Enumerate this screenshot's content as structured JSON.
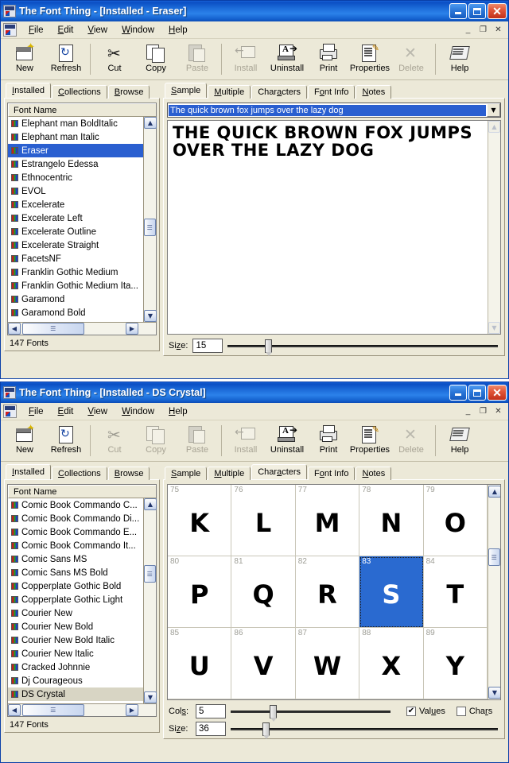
{
  "windows": [
    {
      "title": "The Font Thing - [Installed - Eraser]",
      "titlebar_buttons": {
        "minimize": "minimize-icon",
        "maximize": "maximize-icon",
        "close": "close-icon"
      },
      "mdi_buttons": {
        "minimize": "_",
        "restore": "❐",
        "close": "✕"
      },
      "menu": [
        {
          "pre": "",
          "acc": "F",
          "post": "ile"
        },
        {
          "pre": "",
          "acc": "E",
          "post": "dit"
        },
        {
          "pre": "",
          "acc": "V",
          "post": "iew"
        },
        {
          "pre": "",
          "acc": "W",
          "post": "indow"
        },
        {
          "pre": "",
          "acc": "H",
          "post": "elp"
        }
      ],
      "toolbar": [
        {
          "label": "New",
          "icon": "new-document-icon",
          "disabled": false
        },
        {
          "label": "Refresh",
          "icon": "refresh-icon",
          "disabled": false
        },
        {
          "sep": true
        },
        {
          "label": "Cut",
          "icon": "scissors-icon",
          "disabled": false
        },
        {
          "label": "Copy",
          "icon": "copy-icon",
          "disabled": false
        },
        {
          "label": "Paste",
          "icon": "paste-icon",
          "disabled": true
        },
        {
          "sep": true
        },
        {
          "label": "Install",
          "icon": "install-icon",
          "disabled": true
        },
        {
          "label": "Uninstall",
          "icon": "uninstall-icon",
          "disabled": false
        },
        {
          "label": "Print",
          "icon": "printer-icon",
          "disabled": false
        },
        {
          "label": "Properties",
          "icon": "properties-icon",
          "disabled": false
        },
        {
          "label": "Delete",
          "icon": "delete-x-icon",
          "disabled": true
        },
        {
          "sep": true
        },
        {
          "label": "Help",
          "icon": "help-book-icon",
          "disabled": false
        }
      ],
      "left_tabs": [
        {
          "acc": "I",
          "post": "nstalled",
          "active": true
        },
        {
          "acc": "C",
          "post": "ollections",
          "active": false
        },
        {
          "acc": "B",
          "post": "rowse",
          "active": false
        }
      ],
      "list_header": "Font Name",
      "fonts": [
        {
          "name": "Elephant man BoldItalic",
          "state": ""
        },
        {
          "name": "Elephant man Italic",
          "state": ""
        },
        {
          "name": "Eraser",
          "state": "sel-active"
        },
        {
          "name": "Estrangelo Edessa",
          "state": ""
        },
        {
          "name": "Ethnocentric",
          "state": ""
        },
        {
          "name": "EVOL",
          "state": ""
        },
        {
          "name": "Excelerate",
          "state": ""
        },
        {
          "name": "Excelerate Left",
          "state": ""
        },
        {
          "name": "Excelerate Outline",
          "state": ""
        },
        {
          "name": "Excelerate Straight",
          "state": ""
        },
        {
          "name": "FacetsNF",
          "state": ""
        },
        {
          "name": "Franklin Gothic Medium",
          "state": ""
        },
        {
          "name": "Franklin Gothic Medium Ita...",
          "state": ""
        },
        {
          "name": "Garamond",
          "state": ""
        },
        {
          "name": "Garamond Bold",
          "state": ""
        }
      ],
      "status": "147 Fonts",
      "right_tabs": [
        {
          "acc": "S",
          "post": "ample",
          "pre": "",
          "active": true
        },
        {
          "acc": "M",
          "post": "ultiple",
          "pre": "",
          "active": false
        },
        {
          "acc": "a",
          "post": "cters",
          "pre": "Char",
          "active": false
        },
        {
          "acc": "o",
          "post": "nt Info",
          "pre": "F",
          "active": false
        },
        {
          "acc": "N",
          "post": "otes",
          "pre": "",
          "active": false
        }
      ],
      "sample": {
        "combo_value": "The quick brown fox jumps over the lazy dog",
        "preview_text": "The quick brown fox jumps over the lazy dog",
        "size_label_pre": "Si",
        "size_label_acc": "z",
        "size_label_post": "e:",
        "size_value": "15",
        "slider_percent": 14
      }
    },
    {
      "title": "The Font Thing - [Installed - DS Crystal]",
      "mdi_buttons": {
        "minimize": "_",
        "restore": "❐",
        "close": "✕"
      },
      "menu": [
        {
          "pre": "",
          "acc": "F",
          "post": "ile"
        },
        {
          "pre": "",
          "acc": "E",
          "post": "dit"
        },
        {
          "pre": "",
          "acc": "V",
          "post": "iew"
        },
        {
          "pre": "",
          "acc": "W",
          "post": "indow"
        },
        {
          "pre": "",
          "acc": "H",
          "post": "elp"
        }
      ],
      "toolbar": [
        {
          "label": "New",
          "icon": "new-document-icon",
          "disabled": false
        },
        {
          "label": "Refresh",
          "icon": "refresh-icon",
          "disabled": false
        },
        {
          "sep": true
        },
        {
          "label": "Cut",
          "icon": "scissors-icon",
          "disabled": true
        },
        {
          "label": "Copy",
          "icon": "copy-icon",
          "disabled": true
        },
        {
          "label": "Paste",
          "icon": "paste-icon",
          "disabled": true
        },
        {
          "sep": true
        },
        {
          "label": "Install",
          "icon": "install-icon",
          "disabled": true
        },
        {
          "label": "Uninstall",
          "icon": "uninstall-icon",
          "disabled": false
        },
        {
          "label": "Print",
          "icon": "printer-icon",
          "disabled": false
        },
        {
          "label": "Properties",
          "icon": "properties-icon",
          "disabled": false
        },
        {
          "label": "Delete",
          "icon": "delete-x-icon",
          "disabled": true
        },
        {
          "sep": true
        },
        {
          "label": "Help",
          "icon": "help-book-icon",
          "disabled": false
        }
      ],
      "left_tabs": [
        {
          "acc": "I",
          "post": "nstalled",
          "active": true
        },
        {
          "acc": "C",
          "post": "ollections",
          "active": false
        },
        {
          "acc": "B",
          "post": "rowse",
          "active": false
        }
      ],
      "list_header": "Font Name",
      "fonts": [
        {
          "name": "Comic Book Commando C...",
          "state": ""
        },
        {
          "name": "Comic Book Commando Di...",
          "state": ""
        },
        {
          "name": "Comic Book Commando E...",
          "state": ""
        },
        {
          "name": "Comic Book Commando It...",
          "state": ""
        },
        {
          "name": "Comic Sans MS",
          "state": ""
        },
        {
          "name": "Comic Sans MS Bold",
          "state": ""
        },
        {
          "name": "Copperplate Gothic Bold",
          "state": ""
        },
        {
          "name": "Copperplate Gothic Light",
          "state": ""
        },
        {
          "name": "Courier New",
          "state": ""
        },
        {
          "name": "Courier New Bold",
          "state": ""
        },
        {
          "name": "Courier New Bold Italic",
          "state": ""
        },
        {
          "name": "Courier New Italic",
          "state": ""
        },
        {
          "name": "Cracked Johnnie",
          "state": ""
        },
        {
          "name": "Dj Courageous",
          "state": ""
        },
        {
          "name": "DS Crystal",
          "state": "sel-inactive"
        }
      ],
      "status": "147 Fonts",
      "right_tabs": [
        {
          "acc": "S",
          "post": "ample",
          "pre": "",
          "active": false
        },
        {
          "acc": "M",
          "post": "ultiple",
          "pre": "",
          "active": false
        },
        {
          "acc": "a",
          "post": "cters",
          "pre": "Char",
          "active": true
        },
        {
          "acc": "o",
          "post": "nt Info",
          "pre": "F",
          "active": false
        },
        {
          "acc": "N",
          "post": "otes",
          "pre": "",
          "active": false
        }
      ],
      "characters": {
        "cells": [
          {
            "code": "75",
            "glyph": "K",
            "selected": false
          },
          {
            "code": "76",
            "glyph": "L",
            "selected": false
          },
          {
            "code": "77",
            "glyph": "M",
            "selected": false
          },
          {
            "code": "78",
            "glyph": "N",
            "selected": false
          },
          {
            "code": "79",
            "glyph": "O",
            "selected": false
          },
          {
            "code": "80",
            "glyph": "P",
            "selected": false
          },
          {
            "code": "81",
            "glyph": "Q",
            "selected": false
          },
          {
            "code": "82",
            "glyph": "R",
            "selected": false
          },
          {
            "code": "83",
            "glyph": "S",
            "selected": true
          },
          {
            "code": "84",
            "glyph": "T",
            "selected": false
          },
          {
            "code": "85",
            "glyph": "U",
            "selected": false
          },
          {
            "code": "86",
            "glyph": "V",
            "selected": false
          },
          {
            "code": "87",
            "glyph": "W",
            "selected": false
          },
          {
            "code": "88",
            "glyph": "X",
            "selected": false
          },
          {
            "code": "89",
            "glyph": "Y",
            "selected": false
          }
        ],
        "cols_label_pre": "Col",
        "cols_label_acc": "s",
        "cols_label_post": ":",
        "cols_value": "5",
        "cols_slider_percent": 25,
        "size_label_pre": "Si",
        "size_label_acc": "z",
        "size_label_post": "e:",
        "size_value": "36",
        "size_slider_percent": 12,
        "values_checkbox": {
          "label_pre": "Val",
          "label_acc": "u",
          "label_post": "es",
          "checked": true
        },
        "chars_checkbox": {
          "label_pre": "Cha",
          "label_acc": "r",
          "label_post": "s",
          "checked": false
        }
      }
    }
  ],
  "colors": {
    "titlebar_blue": "#1861d6",
    "face": "#ece9d8",
    "selection_blue": "#2a5fd0",
    "char_selection_blue": "#2a6ad0",
    "inactive_selection": "#d8d5c4",
    "close_red": "#c1301a"
  }
}
